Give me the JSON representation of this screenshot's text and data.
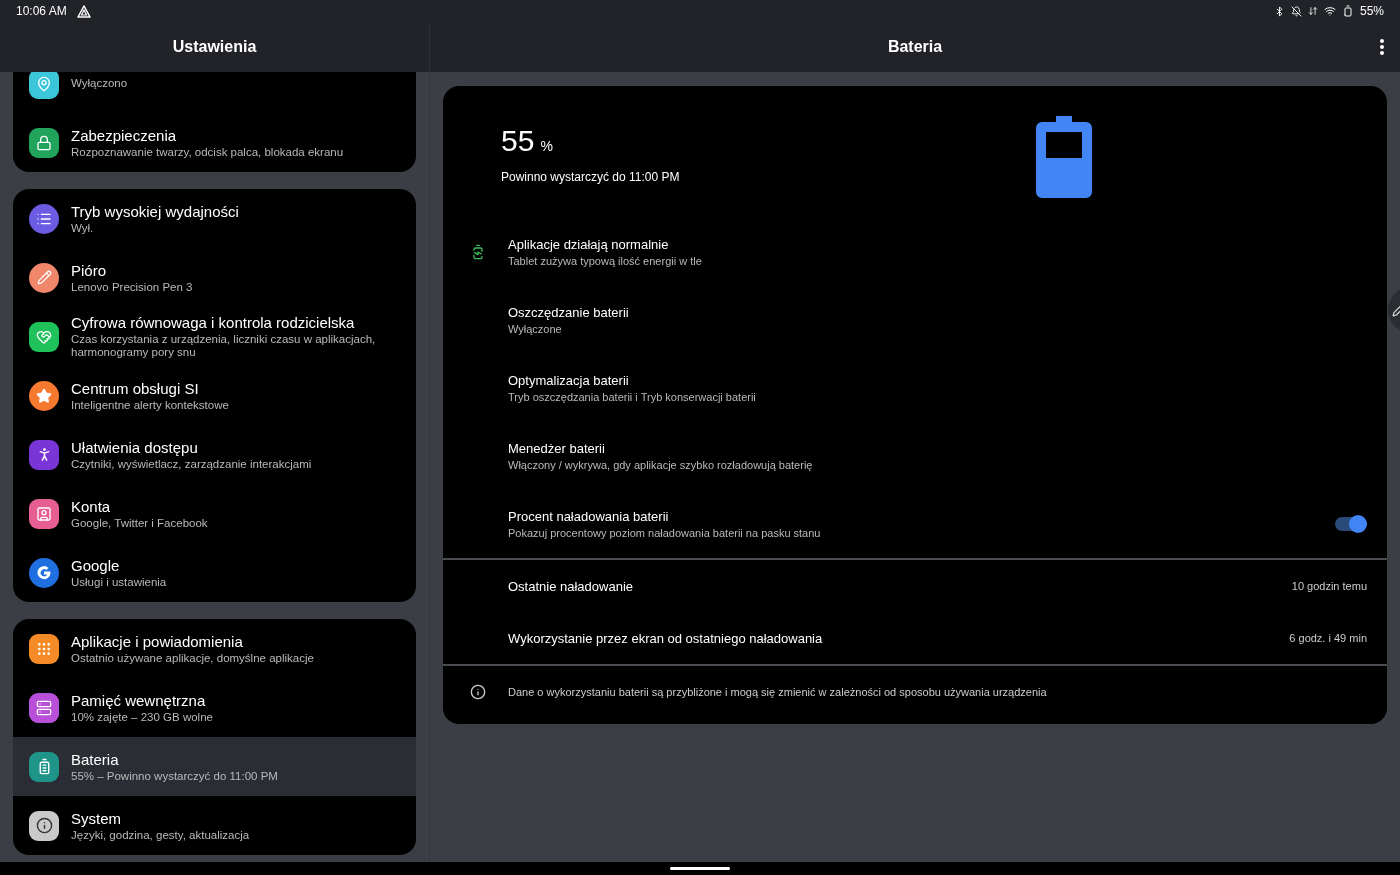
{
  "status_bar": {
    "time": "10:06 AM",
    "battery": "55%"
  },
  "settings": {
    "title": "Ustawienia",
    "groups": [
      {
        "items": [
          {
            "subtitle": "Wyłączono",
            "selected": false
          },
          {
            "title": "Zabezpieczenia",
            "subtitle": "Rozpoznawanie twarzy, odcisk palca, blokada ekranu",
            "selected": false
          }
        ]
      },
      {
        "items": [
          {
            "title": "Tryb wysokiej wydajności",
            "subtitle": "Wył.",
            "selected": false
          },
          {
            "title": "Pióro",
            "subtitle": "Lenovo Precision Pen 3",
            "selected": false
          },
          {
            "title": "Cyfrowa równowaga i kontrola rodzicielska",
            "subtitle": "Czas korzystania z urządzenia, liczniki czasu w aplikacjach, harmonogramy pory snu",
            "selected": false
          },
          {
            "title": "Centrum obsługi SI",
            "subtitle": "Inteligentne alerty kontekstowe",
            "selected": false
          },
          {
            "title": "Ułatwienia dostępu",
            "subtitle": "Czytniki, wyświetlacz, zarządzanie interakcjami",
            "selected": false
          },
          {
            "title": "Konta",
            "subtitle": "Google, Twitter i Facebook",
            "selected": false
          },
          {
            "title": "Google",
            "subtitle": "Usługi i ustawienia",
            "selected": false
          }
        ]
      },
      {
        "items": [
          {
            "title": "Aplikacje i powiadomienia",
            "subtitle": "Ostatnio używane aplikacje, domyślne aplikacje",
            "selected": false
          },
          {
            "title": "Pamięć wewnętrzna",
            "subtitle": "10% zajęte – 230 GB wolne",
            "selected": false
          },
          {
            "title": "Bateria",
            "subtitle": "55% – Powinno wystarczyć do 11:00 PM",
            "selected": true
          },
          {
            "title": "System",
            "subtitle": "Języki, godzina, gesty, aktualizacja",
            "selected": false
          }
        ]
      }
    ]
  },
  "battery": {
    "title": "Bateria",
    "percent": "55",
    "unit": "%",
    "estimate": "Powinno wystarczyć do 11:00 PM",
    "rows": [
      {
        "kind": "status",
        "title": "Aplikacje działają normalnie",
        "subtitle": "Tablet zużywa typową ilość energii w tle"
      },
      {
        "kind": "plain",
        "title": "Oszczędzanie baterii",
        "subtitle": "Wyłączone"
      },
      {
        "kind": "plain",
        "title": "Optymalizacja baterii",
        "subtitle": "Tryb oszczędzania baterii i Tryb konserwacji baterii"
      },
      {
        "kind": "plain",
        "title": "Menedżer baterii",
        "subtitle": "Włączony / wykrywa, gdy aplikacje szybko rozładowują baterię"
      },
      {
        "kind": "toggle",
        "title": "Procent naładowania baterii",
        "subtitle": "Pokazuj procentowy poziom naładowania baterii na pasku stanu",
        "on": true
      }
    ],
    "usage": [
      {
        "label": "Ostatnie naładowanie",
        "value": "10 godzin temu"
      },
      {
        "label": "Wykorzystanie przez ekran od ostatniego naładowania",
        "value": "6 godz. i 49 min"
      }
    ],
    "note": "Dane o wykorzystaniu baterii są przybliżone i mogą się zmienić w zależności od sposobu używania urządzenia"
  }
}
